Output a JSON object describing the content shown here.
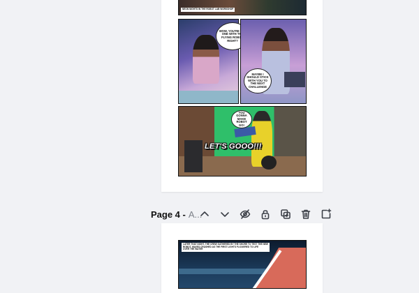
{
  "pages": [
    {
      "id": "page-3",
      "panels": [
        {
          "caption": "NEON NIGHTS IN THE ROBOT LAB WORKSHOP"
        },
        {
          "bubble": "WOW, YOU'RE THE ONE WITH THE FLYING ROBOT, RIGHT?"
        },
        {
          "bubble": "MAYBE I SHOULD STICK WITH YOU TO THE NEXT CHALLENGE"
        },
        {
          "bubble": "YOU GONNA MAKE ROBOT GO!",
          "shout": "LET'S GOOO!!!"
        }
      ]
    },
    {
      "id": "page-4",
      "label": "Page 4",
      "separator": " -",
      "title": "A...",
      "caption_lines": [
        "LATER THAT NIGHT, THE CREW GATHERED BY THE SHORE TO TEST THE NEW",
        "ROBOT. WAVES CRASHED AS THE FIRST LIGHTS FLICKERED TO LIFE",
        "OVER THE WATER"
      ]
    }
  ],
  "toolbar": {
    "items": [
      {
        "name": "move-page-up",
        "icon": "chevron-up-icon"
      },
      {
        "name": "move-page-down",
        "icon": "chevron-down-icon"
      },
      {
        "name": "hide-page",
        "icon": "eye-slash-icon"
      },
      {
        "name": "lock-page",
        "icon": "unlock-icon"
      },
      {
        "name": "duplicate-page",
        "icon": "duplicate-icon"
      },
      {
        "name": "delete-page",
        "icon": "trash-icon"
      },
      {
        "name": "add-page",
        "icon": "add-page-icon"
      }
    ]
  },
  "colors": {
    "canvas_bg": "#f1f2f5",
    "page_bg": "#ffffff",
    "icon": "#3b3f47",
    "label": "#111111",
    "title_muted": "#7d8189"
  }
}
